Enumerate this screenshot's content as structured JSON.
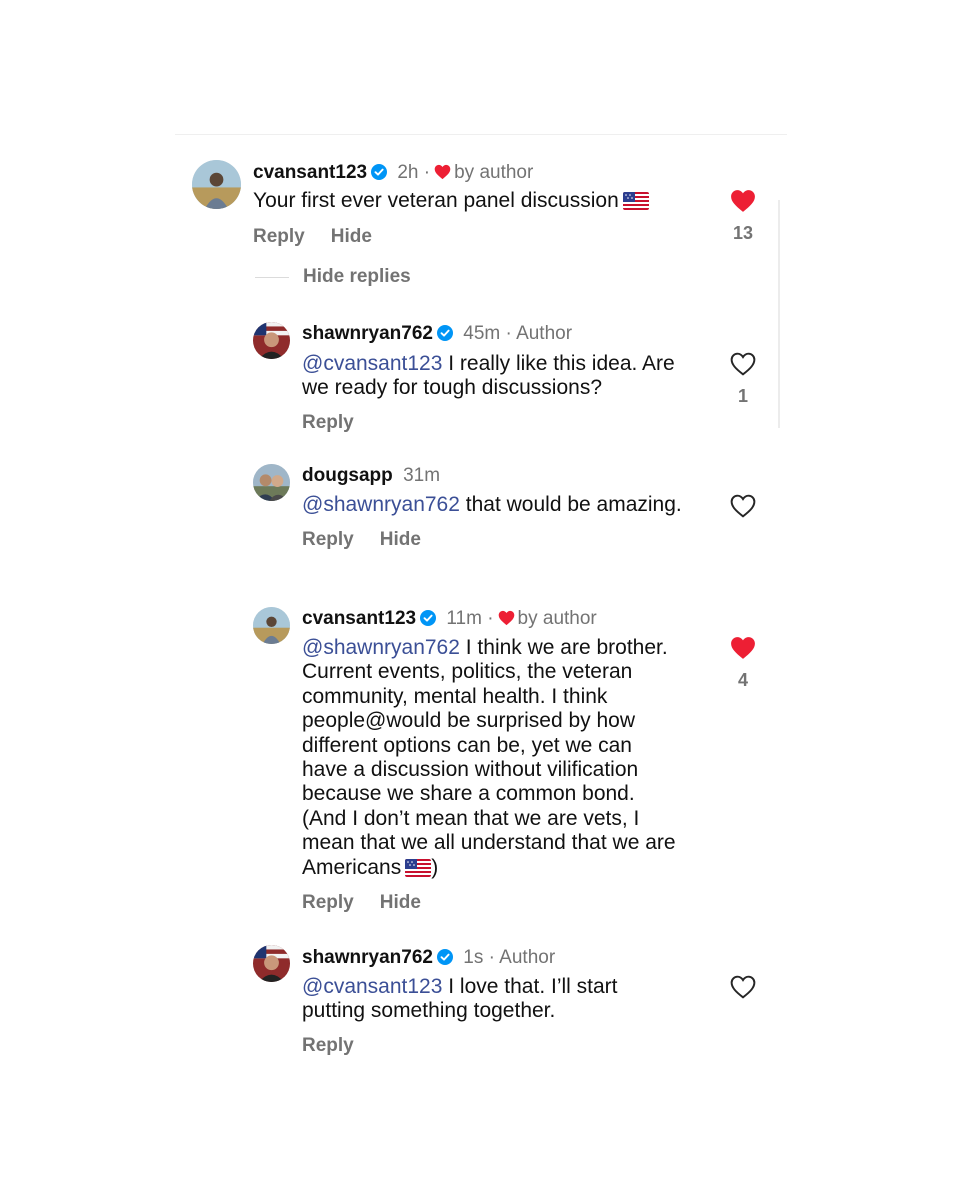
{
  "comments": [
    {
      "username": "cvansant123",
      "time": "2h",
      "sep": "·",
      "tag": "by author",
      "text_parts": [
        "Your first ever veteran panel discussion"
      ],
      "reply_label": "Reply",
      "hide_label": "Hide",
      "like_count": "13",
      "liked": true
    },
    {
      "username": "shawnryan762",
      "time": "45m",
      "sep": "·",
      "tag": "Author",
      "mention": "@cvansant123",
      "text_parts": [
        "I really like this idea. Are",
        "we ready for tough discussions?"
      ],
      "reply_label": "Reply",
      "like_count": "1",
      "liked": false
    },
    {
      "username": "dougsapp",
      "time": "31m",
      "mention": "@shawnryan762",
      "text_parts": [
        "that would be amazing."
      ],
      "reply_label": "Reply",
      "hide_label": "Hide",
      "liked": false
    },
    {
      "username": "cvansant123",
      "time": "11m",
      "sep": "·",
      "tag": "by author",
      "mention": "@shawnryan762",
      "text_parts": [
        "I think we are brother.",
        "Current events, politics, the veteran",
        "community, mental health. I think",
        "people@would be surprised by how",
        "different options can be, yet we can",
        "have a discussion without vilification",
        "because we share a common bond.",
        "(And I don’t mean that we are vets, I",
        "mean that we all understand that we are",
        "Americans",
        ")"
      ],
      "reply_label": "Reply",
      "hide_label": "Hide",
      "like_count": "4",
      "liked": true
    },
    {
      "username": "shawnryan762",
      "time": "1s",
      "sep": "·",
      "tag": "Author",
      "mention": "@cvansant123",
      "text_parts": [
        "I love that. I’ll start",
        "putting something together."
      ],
      "reply_label": "Reply",
      "liked": false
    }
  ],
  "thread": {
    "hide_replies_label": "Hide replies"
  },
  "colors": {
    "liked_heart": "#ed1f34",
    "verified_badge": "#0095f6",
    "mention": "#3b4f96",
    "secondary_text": "#737373"
  },
  "icons": {
    "like": "heart-icon",
    "verified": "verified-badge-icon",
    "flag": "us-flag-emoji"
  }
}
